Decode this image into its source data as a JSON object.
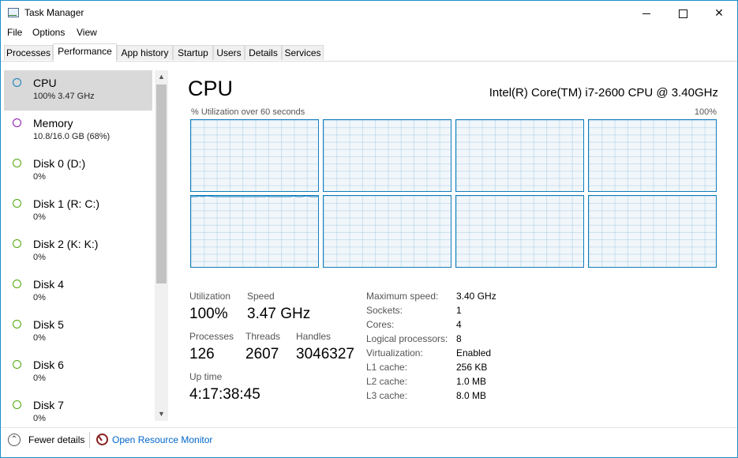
{
  "window": {
    "title": "Task Manager"
  },
  "menu": [
    "File",
    "Options",
    "View"
  ],
  "tabs": [
    "Processes",
    "Performance",
    "App history",
    "Startup",
    "Users",
    "Details",
    "Services"
  ],
  "active_tab": "Performance",
  "sidebar": {
    "items": [
      {
        "name": "CPU",
        "sub": "100%  3.47 GHz",
        "color": "#117dbb",
        "selected": true
      },
      {
        "name": "Memory",
        "sub": "10.8/16.0 GB (68%)",
        "color": "#8b12ae",
        "selected": false
      },
      {
        "name": "Disk 0 (D:)",
        "sub": "0%",
        "color": "#4da60c",
        "selected": false
      },
      {
        "name": "Disk 1 (R: C:)",
        "sub": "0%",
        "color": "#4da60c",
        "selected": false
      },
      {
        "name": "Disk 2 (K: K:)",
        "sub": "0%",
        "color": "#4da60c",
        "selected": false
      },
      {
        "name": "Disk 4",
        "sub": "0%",
        "color": "#4da60c",
        "selected": false
      },
      {
        "name": "Disk 5",
        "sub": "0%",
        "color": "#4da60c",
        "selected": false
      },
      {
        "name": "Disk 6",
        "sub": "0%",
        "color": "#4da60c",
        "selected": false
      },
      {
        "name": "Disk 7",
        "sub": "0%",
        "color": "#4da60c",
        "selected": false
      }
    ]
  },
  "main": {
    "title": "CPU",
    "cpu_model": "Intel(R) Core(TM) i7-2600 CPU @ 3.40GHz",
    "graph_caption": "% Utilization over 60 seconds",
    "graph_max": "100%",
    "graph_color": "#117dbb",
    "graph_count": 8,
    "stats": {
      "utilization_label": "Utilization",
      "utilization": "100%",
      "speed_label": "Speed",
      "speed": "3.47 GHz",
      "processes_label": "Processes",
      "processes": "126",
      "threads_label": "Threads",
      "threads": "2607",
      "handles_label": "Handles",
      "handles": "3046327",
      "uptime_label": "Up time",
      "uptime": "4:17:38:45"
    },
    "specs": [
      {
        "label": "Maximum speed:",
        "value": "3.40 GHz"
      },
      {
        "label": "Sockets:",
        "value": "1"
      },
      {
        "label": "Cores:",
        "value": "4"
      },
      {
        "label": "Logical processors:",
        "value": "8"
      },
      {
        "label": "Virtualization:",
        "value": "Enabled"
      },
      {
        "label": "L1 cache:",
        "value": "256 KB"
      },
      {
        "label": "L2 cache:",
        "value": "1.0 MB"
      },
      {
        "label": "L3 cache:",
        "value": "8.0 MB"
      }
    ]
  },
  "footer": {
    "fewer_details": "Fewer details",
    "open_resource_monitor": "Open Resource Monitor"
  }
}
